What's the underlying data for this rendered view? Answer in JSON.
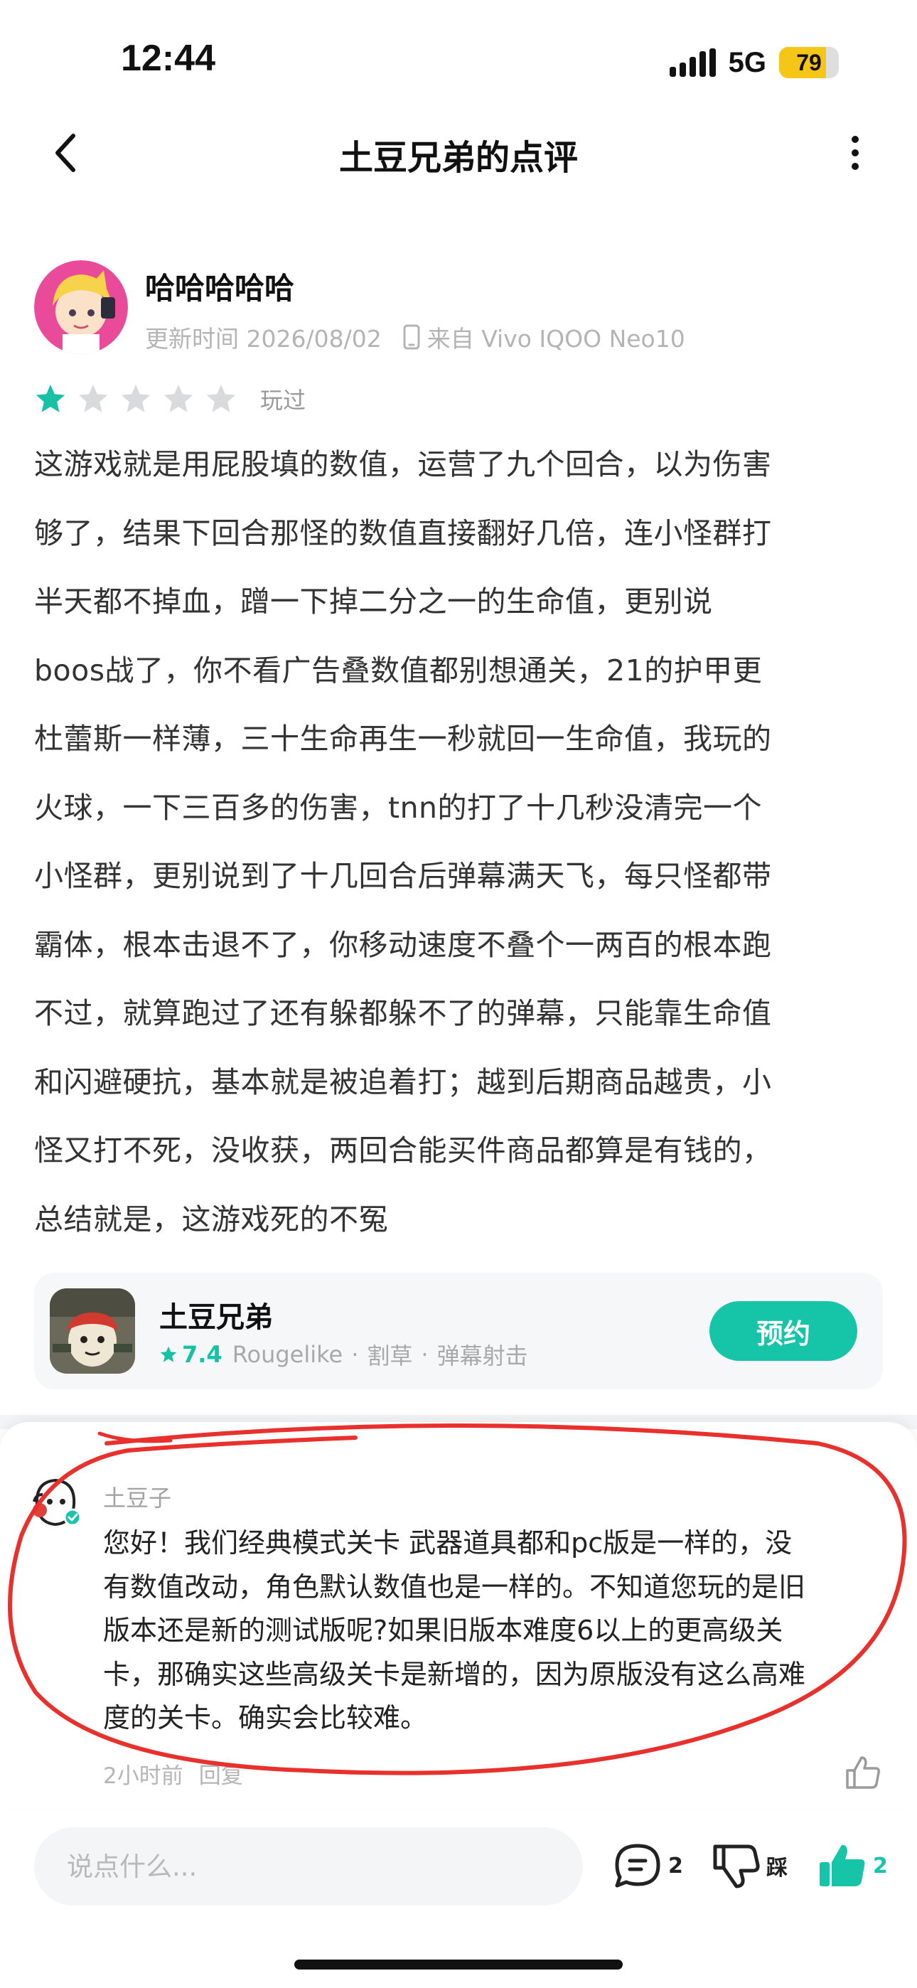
{
  "status_bar": {
    "time": "12:44",
    "network": "5G",
    "battery": "79",
    "battery_level": 0.79
  },
  "header": {
    "title": "土豆兄弟的点评"
  },
  "review": {
    "author": "哈哈哈哈哈",
    "updated": "更新时间 2026/08/02",
    "device": "来自 Vivo IQOO Neo10",
    "rating": 1,
    "rating_max": 5,
    "played_label": "玩过",
    "lines": [
      "这游戏就是用屁股填的数值，运营了九个回合，以为伤害",
      "够了，结果下回合那怪的数值直接翻好几倍，连小怪群打",
      "半天都不掉血，蹭一下掉二分之一的生命值，更别说",
      "boos战了，你不看广告叠数值都别想通关，21的护甲更",
      "杜蕾斯一样薄，三十生命再生一秒就回一生命值，我玩的",
      "火球，一下三百多的伤害，tnn的打了十几秒没清完一个",
      "小怪群，更别说到了十几回合后弹幕满天飞，每只怪都带",
      "霸体，根本击退不了，你移动速度不叠个一两百的根本跑",
      "不过，就算跑过了还有躲都躲不了的弹幕，只能靠生命值",
      "和闪避硬抗，基本就是被追着打；越到后期商品越贵，小",
      "怪又打不死，没收获，两回合能买件商品都算是有钱的，",
      "总结就是，这游戏死的不冤"
    ]
  },
  "game_card": {
    "name": "土豆兄弟",
    "score": "7.4",
    "tags": [
      "Rougelike",
      "割草",
      "弹幕射击"
    ],
    "button_label": "预约"
  },
  "reply": {
    "author": "土豆子",
    "lines": [
      "您好！我们经典模式关卡 武器道具都和pc版是一样的，没",
      "有数值改动，角色默认数值也是一样的。不知道您玩的是旧",
      "版本还是新的测试版呢?如果旧版本难度6以上的更高级关",
      "卡，那确实这些高级关卡是新增的，因为原版没有这么高难",
      "度的关卡。确实会比较难。"
    ],
    "time": "2小时前",
    "reply_label": "回复"
  },
  "bottom_bar": {
    "input_placeholder": "说点什么...",
    "comment_count": "2",
    "dislike_label": "踩",
    "like_count": "2"
  },
  "colors": {
    "accent": "#16c5a8",
    "star_active": "#17c1a5",
    "star_inactive": "#d8dadc",
    "annotation": "#e8312c"
  }
}
